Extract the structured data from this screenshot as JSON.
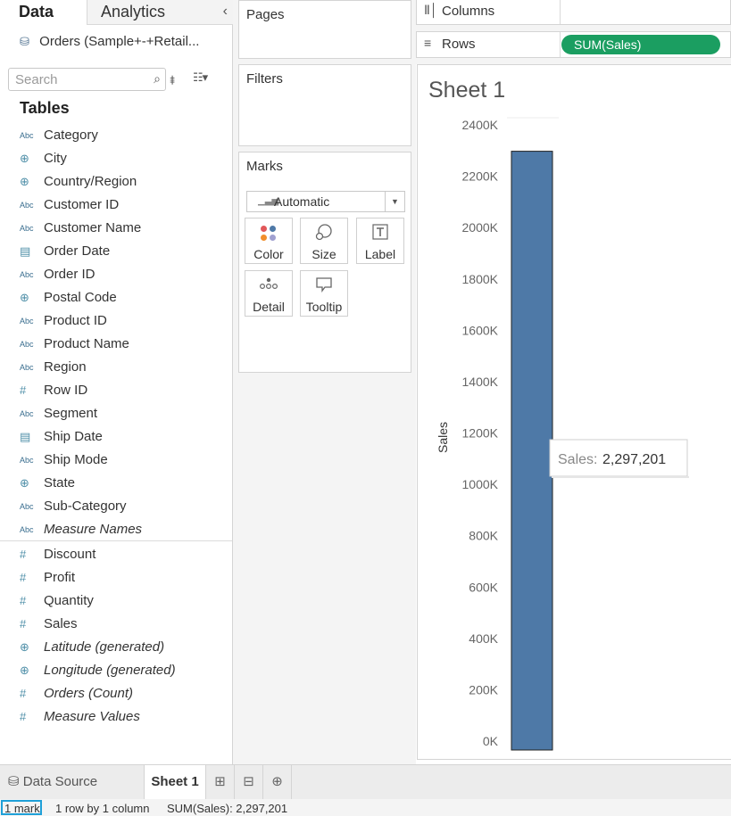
{
  "pane": {
    "tabs": [
      "Data",
      "Analytics"
    ],
    "collapse": "‹",
    "datasource": "Orders (Sample+-+Retail...",
    "search_placeholder": "Search",
    "tables_heading": "Tables",
    "dimensions": [
      {
        "type": "Abc",
        "label": "Category"
      },
      {
        "type": "globe",
        "label": "City"
      },
      {
        "type": "globe",
        "label": "Country/Region"
      },
      {
        "type": "Abc",
        "label": "Customer ID"
      },
      {
        "type": "Abc",
        "label": "Customer Name"
      },
      {
        "type": "cal",
        "label": "Order Date"
      },
      {
        "type": "Abc",
        "label": "Order ID"
      },
      {
        "type": "globe",
        "label": "Postal Code"
      },
      {
        "type": "Abc",
        "label": "Product ID"
      },
      {
        "type": "Abc",
        "label": "Product Name"
      },
      {
        "type": "Abc",
        "label": "Region"
      },
      {
        "type": "hash",
        "label": "Row ID"
      },
      {
        "type": "Abc",
        "label": "Segment"
      },
      {
        "type": "cal",
        "label": "Ship Date"
      },
      {
        "type": "Abc",
        "label": "Ship Mode"
      },
      {
        "type": "globe",
        "label": "State"
      },
      {
        "type": "Abc",
        "label": "Sub-Category"
      },
      {
        "type": "Abc",
        "label": "Measure Names",
        "italic": true
      }
    ],
    "measures": [
      {
        "type": "hash",
        "label": "Discount"
      },
      {
        "type": "hash",
        "label": "Profit"
      },
      {
        "type": "hash",
        "label": "Quantity"
      },
      {
        "type": "hash",
        "label": "Sales"
      },
      {
        "type": "globe",
        "label": "Latitude (generated)",
        "italic": true
      },
      {
        "type": "globe",
        "label": "Longitude (generated)",
        "italic": true
      },
      {
        "type": "hash",
        "label": "Orders (Count)",
        "italic": true
      },
      {
        "type": "hash",
        "label": "Measure Values",
        "italic": true
      }
    ]
  },
  "cards": {
    "pages": "Pages",
    "filters": "Filters",
    "marks": "Marks",
    "mark_type": "Automatic",
    "mark_buttons": {
      "color": "Color",
      "size": "Size",
      "label": "Label",
      "detail": "Detail",
      "tooltip": "Tooltip"
    }
  },
  "shelves": {
    "columns": "Columns",
    "rows": "Rows",
    "rows_pill": "SUM(Sales)"
  },
  "colors": {
    "bar": "#4e79a7",
    "pill": "#1b9e61",
    "accent": "#1fa0d8"
  },
  "sheet": {
    "title": "Sheet 1"
  },
  "chart_data": {
    "type": "bar",
    "categories": [
      ""
    ],
    "values": [
      2297201
    ],
    "title": "Sheet 1",
    "xlabel": "",
    "ylabel": "Sales",
    "ylim": [
      0,
      2400000
    ],
    "yticks": [
      0,
      200000,
      400000,
      600000,
      800000,
      1000000,
      1200000,
      1400000,
      1600000,
      1800000,
      2000000,
      2200000,
      2400000
    ],
    "ytick_labels": [
      "0K",
      "200K",
      "400K",
      "600K",
      "800K",
      "1000K",
      "1200K",
      "1400K",
      "1600K",
      "1800K",
      "2000K",
      "2200K",
      "2400K"
    ],
    "grid": false,
    "tooltip": {
      "label": "Sales:",
      "value": "2,297,201"
    }
  },
  "tabs": {
    "datasource": "Data Source",
    "sheet": "Sheet 1"
  },
  "status": {
    "marks": "1 mark",
    "rows": "1 row by 1 column",
    "sum": "SUM(Sales): 2,297,201"
  }
}
